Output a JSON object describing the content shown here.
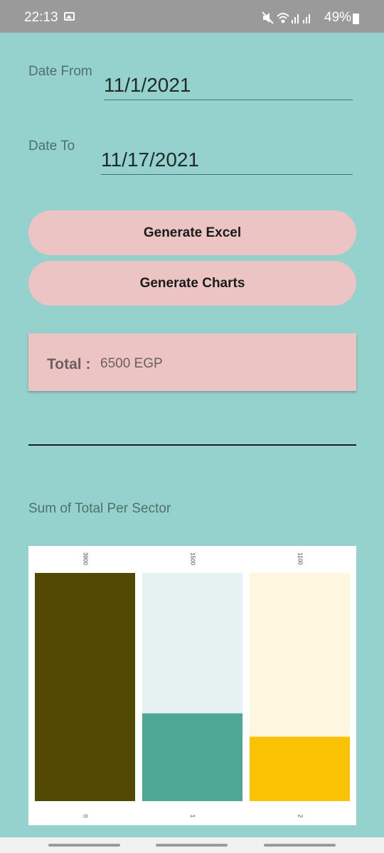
{
  "status_bar": {
    "time": "22:13",
    "battery": "49%"
  },
  "form": {
    "date_from_label": "Date From",
    "date_from_value": "11/1/2021",
    "date_to_label": "Date To",
    "date_to_value": "11/17/2021"
  },
  "buttons": {
    "excel": "Generate Excel",
    "charts": "Generate Charts"
  },
  "total": {
    "label": "Total :",
    "value": "6500 EGP"
  },
  "chart_data": {
    "type": "bar",
    "title": "Sum of Total Per Sector",
    "categories": [
      "0",
      "1",
      "2"
    ],
    "values": [
      3900,
      1500,
      1100
    ],
    "ylim": [
      0,
      3900
    ],
    "colors": [
      "#524905",
      "#4ea794",
      "#f9c304"
    ],
    "track_colors": [
      "#e7f3f1",
      "#e5f2f1",
      "#fef6df"
    ]
  }
}
